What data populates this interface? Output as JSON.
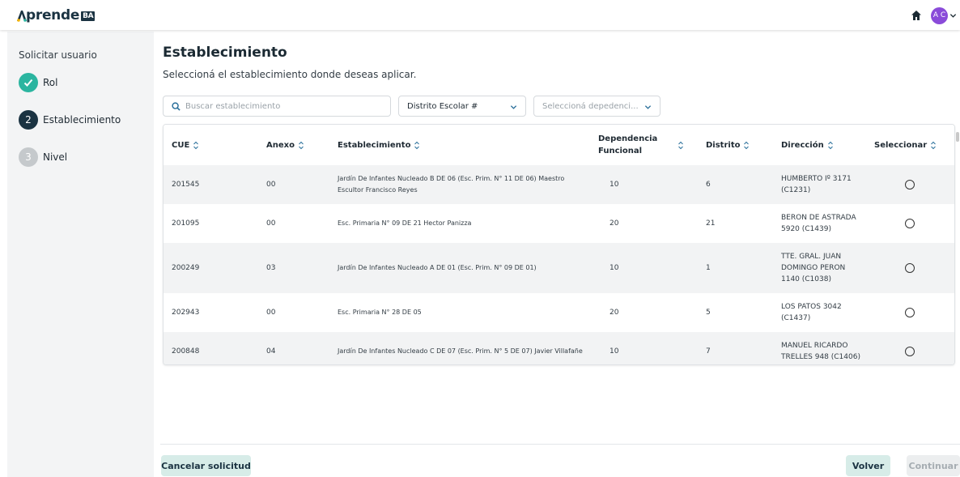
{
  "header": {
    "logo_main": "prende",
    "logo_badge": "BA",
    "avatar_initials": "A C"
  },
  "sidebar": {
    "title": "Solicitar usuario",
    "steps": [
      {
        "label": "Rol",
        "number": "",
        "state": "done",
        "color": "#2bb5a0"
      },
      {
        "label": "Establecimiento",
        "number": "2",
        "state": "active",
        "color": "#1b3342"
      },
      {
        "label": "Nivel",
        "number": "3",
        "state": "pending",
        "color": "#c5c9cc"
      }
    ]
  },
  "main": {
    "title": "Establecimiento",
    "subtitle": "Seleccioná el establecimiento donde deseas aplicar.",
    "search_placeholder": "Buscar establecimiento",
    "district_select": "Distrito Escolar #",
    "dependency_placeholder": "Seleccioná depedenci..."
  },
  "table": {
    "columns": [
      "CUE",
      "Anexo",
      "Establecimiento",
      "Dependencia Funcional",
      "Distrito",
      "Dirección",
      "Seleccionar"
    ],
    "rows": [
      {
        "cue": "201545",
        "anexo": "00",
        "establecimiento": "Jardín De Infantes Nucleado B DE 06 (Esc. Prim. N° 11 DE 06) Maestro Escultor Francisco Reyes",
        "dependencia": "10",
        "distrito": "6",
        "direccion": "HUMBERTO Iº 3171 (C1231)"
      },
      {
        "cue": "201095",
        "anexo": "00",
        "establecimiento": "Esc. Primaria N° 09 DE 21 Hector Panizza",
        "dependencia": "20",
        "distrito": "21",
        "direccion": "BERON DE ASTRADA 5920 (C1439)"
      },
      {
        "cue": "200249",
        "anexo": "03",
        "establecimiento": "Jardín De Infantes Nucleado A DE 01 (Esc. Prim. N° 09 DE 01)",
        "dependencia": "10",
        "distrito": "1",
        "direccion": "TTE. GRAL. JUAN DOMINGO PERON 1140 (C1038)"
      },
      {
        "cue": "202943",
        "anexo": "00",
        "establecimiento": "Esc. Primaria N° 28 DE 05",
        "dependencia": "20",
        "distrito": "5",
        "direccion": "LOS PATOS 3042 (C1437)"
      },
      {
        "cue": "200848",
        "anexo": "04",
        "establecimiento": "Jardín De Infantes Nucleado C DE 07 (Esc. Prim. N° 5 DE 07) Javier Villafañe",
        "dependencia": "10",
        "distrito": "7",
        "direccion": "MANUEL RICARDO TRELLES 948 (C1406)"
      }
    ]
  },
  "footer": {
    "cancel_label": "Cancelar solicitud",
    "back_label": "Volver",
    "continue_label": "Continuar"
  },
  "colors": {
    "accent": "#2bb5a0",
    "primary": "#1b3342",
    "avatar": "#8a4bd9"
  }
}
